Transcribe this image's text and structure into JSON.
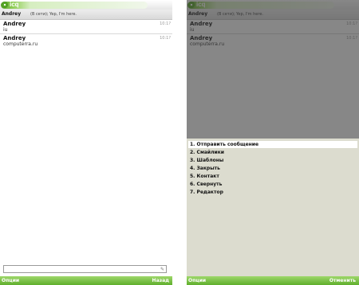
{
  "app": {
    "title": "icq"
  },
  "chat": {
    "contact_name": "Andrey",
    "contact_status": "(В сети);",
    "contact_status_text": "Yep, I'm here.",
    "messages": [
      {
        "author": "Andrey",
        "time": "10:1?",
        "text": "iu"
      },
      {
        "author": "Andrey",
        "time": "10:1?",
        "text": "computerra.ru"
      }
    ],
    "input_value": ""
  },
  "softkeys_left_screen": {
    "left": "Опции",
    "right": "Назад"
  },
  "softkeys_right_screen": {
    "left": "Опции",
    "right": "Отменить"
  },
  "menu": {
    "selected_index": 0,
    "items": [
      "1. Отправить сообщение",
      "2. Смайлики",
      "3. Шаблоны",
      "4. Закрыть",
      "5. Контакт",
      "6. Свернуть",
      "7. Редактор"
    ]
  },
  "colors": {
    "softbar": "#6fbe3c",
    "menu_bg": "#dcdccf",
    "brand": "#5fae2c"
  },
  "icons": {
    "logo": "icq-flower-icon",
    "input": "pencil-icon"
  }
}
